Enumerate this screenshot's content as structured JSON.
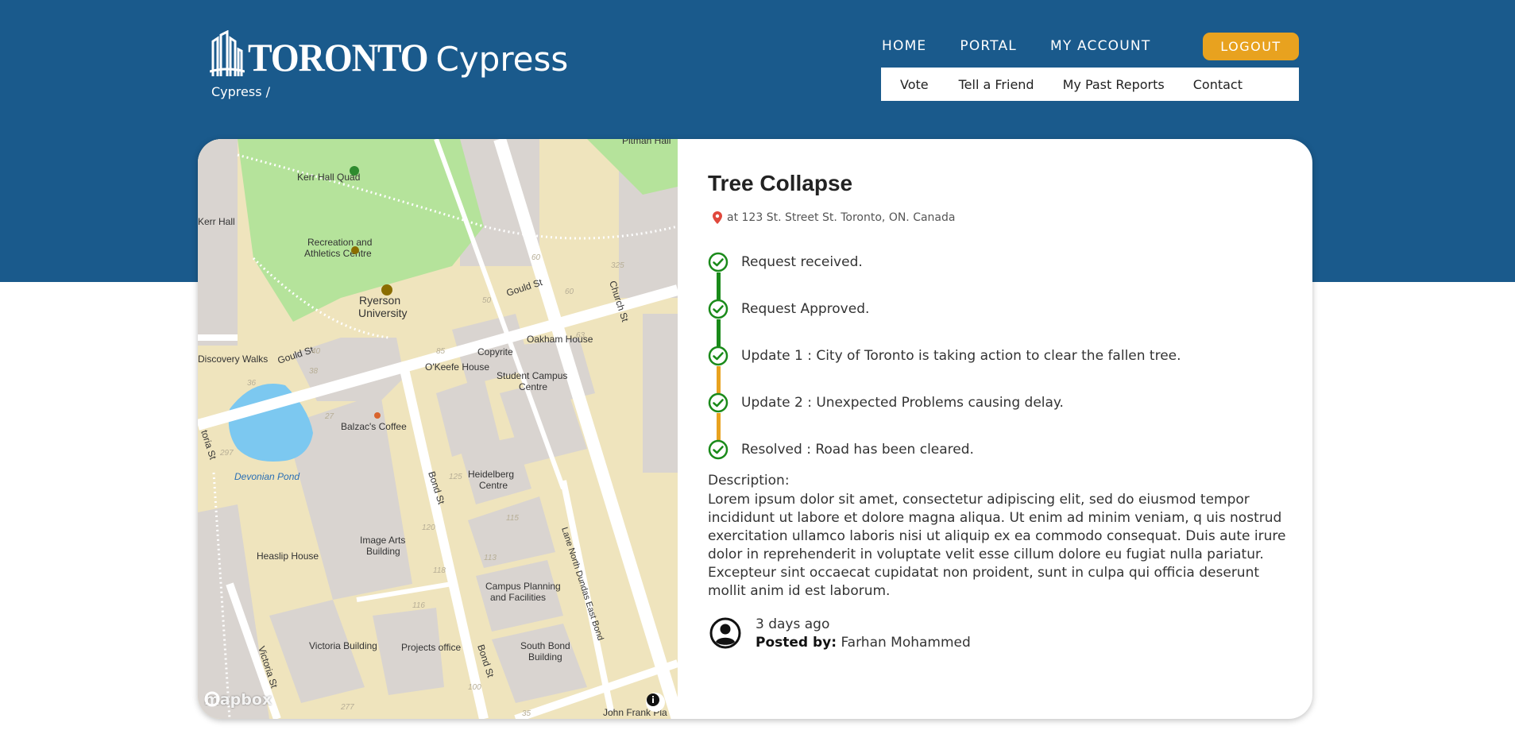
{
  "header": {
    "logo_toronto": "TORONTO",
    "logo_cypress": "Cypress",
    "breadcrumb": "Cypress /",
    "nav": [
      "HOME",
      "PORTAL",
      "MY ACCOUNT"
    ],
    "logout": "LOGOUT",
    "subnav": [
      "Vote",
      "Tell a Friend",
      "My Past Reports",
      "Contact"
    ]
  },
  "report": {
    "title": "Tree Collapse",
    "address": "at 123 St. Street St. Toronto, ON. Canada",
    "timeline": [
      {
        "text": "Request received.",
        "status": "done"
      },
      {
        "text": "Request Approved.",
        "status": "done"
      },
      {
        "text": "Update 1 : City of Toronto is taking action to clear the fallen tree.",
        "status": "done"
      },
      {
        "text": "Update 2 : Unexpected Problems causing delay.",
        "status": "done"
      },
      {
        "text": "Resolved : Road has been cleared.",
        "status": "done"
      }
    ],
    "description_label": "Description:",
    "description": "Lorem ipsum dolor sit amet, consectetur adipiscing elit, sed do eiusmod tempor incididunt ut labore et dolore magna aliqua. Ut enim ad minim veniam, q uis nostrud exercitation ullamco laboris nisi ut aliquip ex ea commodo consequat. Duis aute irure dolor in reprehenderit in voluptate velit esse cillum dolore eu fugiat nulla pariatur. Excepteur sint occaecat cupidatat non proident, sunt in culpa qui officia deserunt mollit anim id est laborum.",
    "posted_time": "3 days ago",
    "posted_by_label": "Posted by:",
    "posted_by": "Farhan Mohammed"
  },
  "map": {
    "attribution_logo": "mapbox",
    "labels": {
      "kerr_hall_quad": "Kerr Hall Quad",
      "kerr_hall": "Kerr Hall",
      "rac_1": "Recreation and",
      "rac_2": "Athletics Centre",
      "ryerson_1": "Ryerson",
      "ryerson_2": "University",
      "gould_st_1": "Gould St",
      "gould_st_2": "Gould St",
      "church_st": "Church St",
      "discovery": "Discovery Walks",
      "oakham": "Oakham House",
      "copyrite": "Copyrite",
      "okeefe": "O'Keefe House",
      "student_1": "Student Campus",
      "student_2": "Centre",
      "balzacs": "Balzac's Coffee",
      "devonian": "Devonian Pond",
      "bond_st_1": "Bond St",
      "bond_st_2": "Bond St",
      "heidelberg_1": "Heidelberg",
      "heidelberg_2": "Centre",
      "image_arts_1": "Image Arts",
      "image_arts_2": "Building",
      "heaslip": "Heaslip House",
      "campus_planning_1": "Campus Planning",
      "campus_planning_2": "and Facilities",
      "lane": "Lane North Dundas East Bond",
      "victoria_building": "Victoria Building",
      "projects": "Projects office",
      "south_bond_1": "South Bond",
      "south_bond_2": "Building",
      "victoria_st": "Victoria St",
      "victoria_st_top": "toria St",
      "john_frank": "John Frank Pla",
      "pitman": "Pitman Hall",
      "n60": "60",
      "n50": "50",
      "n40": "40",
      "n36": "36",
      "n38": "38",
      "n325": "325",
      "n85": "85",
      "n63": "63",
      "n27": "27",
      "n297": "297",
      "n125": "125",
      "n120": "120",
      "n115": "115",
      "n113": "113",
      "n118": "118",
      "n116": "116",
      "n100": "100",
      "n277": "277",
      "n35": "35"
    }
  },
  "colors": {
    "header_bg": "#1a5a8c",
    "logout_bg": "#e8a21f",
    "timeline_green": "#1a8a1a",
    "timeline_orange": "#e8a21f",
    "map_park": "#b5e39b",
    "map_block": "#efe4bd",
    "map_building": "#d9d4d0",
    "map_water": "#7cc8f0"
  }
}
